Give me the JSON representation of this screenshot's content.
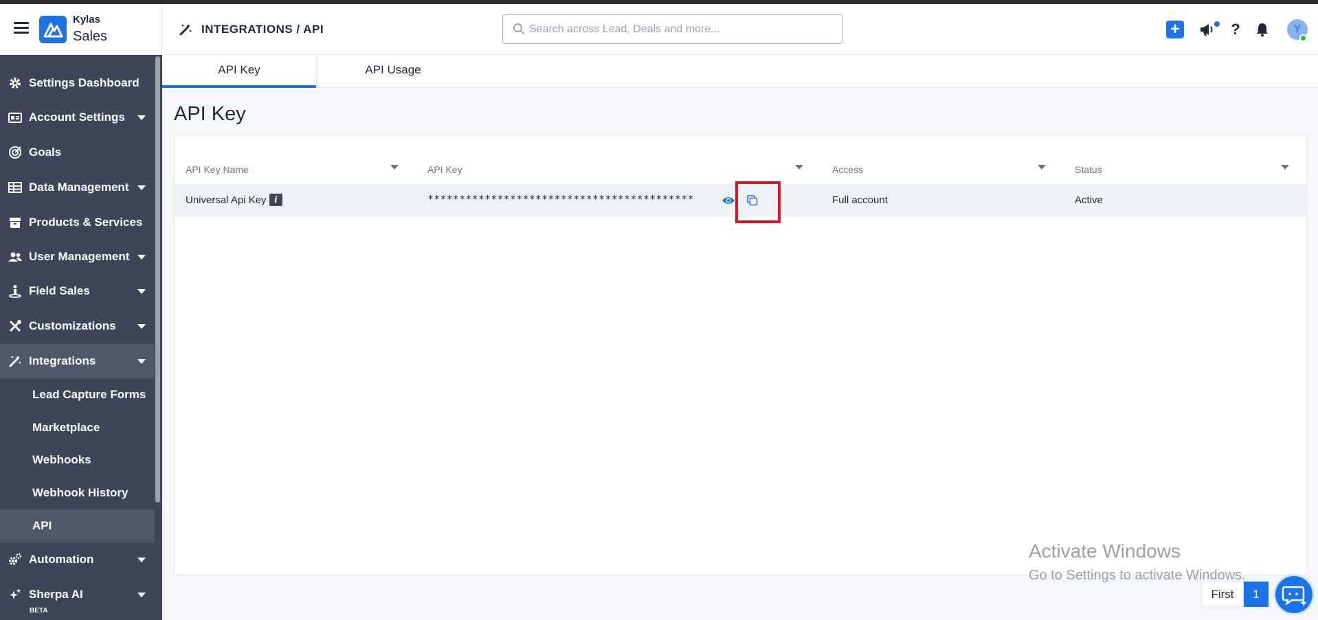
{
  "header": {
    "brand_top": "Kylas",
    "brand_bottom": "Sales",
    "breadcrumb": "INTEGRATIONS / API",
    "search_placeholder": "Search across Lead, Deals and more...",
    "avatar_initial": "Y",
    "help_label": "?",
    "plus_label": "+"
  },
  "sidebar": {
    "items": [
      {
        "label": "Settings Dashboard",
        "icon": "gear-icon"
      },
      {
        "label": "Account Settings",
        "icon": "account-card-icon"
      },
      {
        "label": "Goals",
        "icon": "target-icon"
      },
      {
        "label": "Data Management",
        "icon": "table-icon"
      },
      {
        "label": "Products & Services",
        "icon": "box-icon"
      },
      {
        "label": "User Management",
        "icon": "users-icon"
      },
      {
        "label": "Field Sales",
        "icon": "person-pin-icon"
      },
      {
        "label": "Customizations",
        "icon": "tools-icon"
      },
      {
        "label": "Integrations",
        "icon": "magic-wand-icon"
      },
      {
        "label": "Automation",
        "icon": "gears-icon"
      },
      {
        "label": "Sherpa AI",
        "icon": "sparkle-icon"
      }
    ],
    "sub_items": [
      {
        "label": "Lead Capture Forms"
      },
      {
        "label": "Marketplace"
      },
      {
        "label": "Webhooks"
      },
      {
        "label": "Webhook History"
      },
      {
        "label": "API"
      }
    ],
    "beta_label": "BETA"
  },
  "tabs": [
    {
      "label": "API Key"
    },
    {
      "label": "API Usage"
    }
  ],
  "page_title": "API Key",
  "table": {
    "columns": [
      "API Key Name",
      "API Key",
      "Access",
      "Status"
    ],
    "rows": [
      {
        "name": "Universal Api Key",
        "info": "i",
        "key": "******************************************",
        "access": "Full account",
        "status": "Active"
      }
    ]
  },
  "watermark": {
    "line1": "Activate Windows",
    "line2": "Go to Settings to activate Windows."
  },
  "pagination": {
    "first_label": "First",
    "current_page": "1"
  },
  "colors": {
    "accent": "#1a73e8",
    "sidebar_bg": "#3c4656",
    "highlight": "#e0141e"
  }
}
